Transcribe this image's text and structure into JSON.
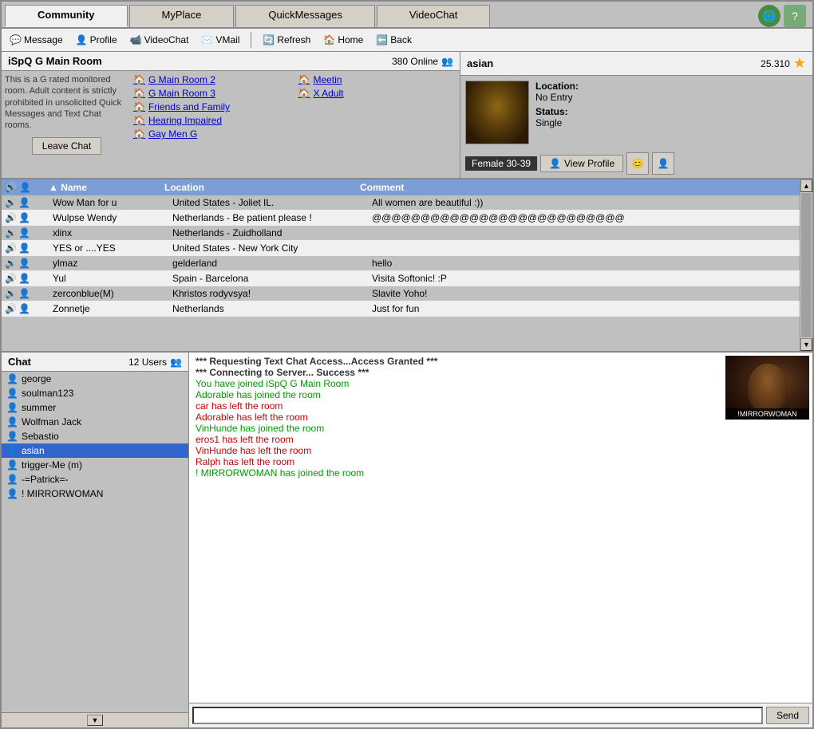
{
  "tabs": [
    {
      "label": "Community",
      "active": true
    },
    {
      "label": "MyPlace",
      "active": false
    },
    {
      "label": "QuickMessages",
      "active": false
    },
    {
      "label": "VideoChat",
      "active": false
    }
  ],
  "toolbar": {
    "buttons": [
      {
        "label": "Message",
        "icon": "💬"
      },
      {
        "label": "Profile",
        "icon": "👤"
      },
      {
        "label": "VideoChat",
        "icon": "📹"
      },
      {
        "label": "VMail",
        "icon": "✉️"
      },
      {
        "label": "Refresh",
        "icon": "🔄"
      },
      {
        "label": "Home",
        "icon": "🏠"
      },
      {
        "label": "Back",
        "icon": "⬅️"
      }
    ]
  },
  "room": {
    "title": "iSpQ G Main Room",
    "online_count": "380 Online",
    "description": "This is a G rated monitored room. Adult content is strictly prohibited in unsolicited Quick Messages and Text Chat rooms.",
    "leave_btn": "Leave Chat",
    "links_col1": [
      {
        "label": "G Main Room 2"
      },
      {
        "label": "G Main Room 3"
      },
      {
        "label": "Friends and Family"
      },
      {
        "label": "Hearing Impaired"
      },
      {
        "label": "Gay Men G"
      }
    ],
    "links_col2": [
      {
        "label": "Meetin"
      },
      {
        "label": "X Adult"
      }
    ]
  },
  "profile": {
    "name": "asian",
    "score": "25.310",
    "location_label": "Location:",
    "location_value": "No Entry",
    "status_label": "Status:",
    "status_value": "Single",
    "gender_age": "Female  30-39",
    "view_profile_btn": "View Profile"
  },
  "user_table": {
    "headers": [
      "Name",
      "Location",
      "Comment"
    ],
    "rows": [
      {
        "name": "Wow Man for u",
        "location": "United States - Joliet IL.",
        "comment": "All women are beautiful :))"
      },
      {
        "name": "Wulpse Wendy",
        "location": "Netherlands - Be patient please !",
        "comment": "@@@@@@@@@@@@@@@@@@@@@@@@@@"
      },
      {
        "name": "xlinx",
        "location": "Netherlands - Zuidholland",
        "comment": ""
      },
      {
        "name": "YES or ....YES",
        "location": "United States - New York City",
        "comment": ""
      },
      {
        "name": "ylmaz",
        "location": "gelderland",
        "comment": "hello"
      },
      {
        "name": "Yul",
        "location": "Spain - Barcelona",
        "comment": "Visita Softonic! :P"
      },
      {
        "name": "zerconblue(M)",
        "location": "Khristos rodyvsya!",
        "comment": "Slavite Yoho!"
      },
      {
        "name": "Zonnetje",
        "location": "Netherlands",
        "comment": "Just for fun"
      }
    ]
  },
  "chat": {
    "title": "Chat",
    "user_count": "12 Users",
    "users": [
      {
        "name": "george",
        "selected": false
      },
      {
        "name": "soulman123",
        "selected": false
      },
      {
        "name": "summer",
        "selected": false
      },
      {
        "name": "Wolfman Jack",
        "selected": false
      },
      {
        "name": "Sebastio",
        "selected": false
      },
      {
        "name": "asian",
        "selected": true
      },
      {
        "name": "trigger-Me (m)",
        "selected": false
      },
      {
        "name": "-=Patrick=-",
        "selected": false
      },
      {
        "name": "!     MIRRORWOMAN",
        "selected": false
      }
    ],
    "messages": [
      {
        "text": "*** Requesting Text Chat Access...Access Granted ***",
        "type": "system"
      },
      {
        "text": "*** Connecting to Server... Success ***",
        "type": "system"
      },
      {
        "text": "You have joined iSpQ G Main Room",
        "type": "join"
      },
      {
        "text": "Adorable has joined the room",
        "type": "join"
      },
      {
        "text": "car has left the room",
        "type": "leave"
      },
      {
        "text": "Adorable has left the room",
        "type": "leave"
      },
      {
        "text": "VinHunde has joined the room",
        "type": "join"
      },
      {
        "text": "eros1 has left the room",
        "type": "leave"
      },
      {
        "text": "VinHunde has left the room",
        "type": "leave"
      },
      {
        "text": "Ralph has left the room",
        "type": "leave"
      },
      {
        "text": "!       MIRRORWOMAN has joined the room",
        "type": "join"
      }
    ],
    "send_label": "Send",
    "video_user": "!MIRRORWOMAN"
  }
}
